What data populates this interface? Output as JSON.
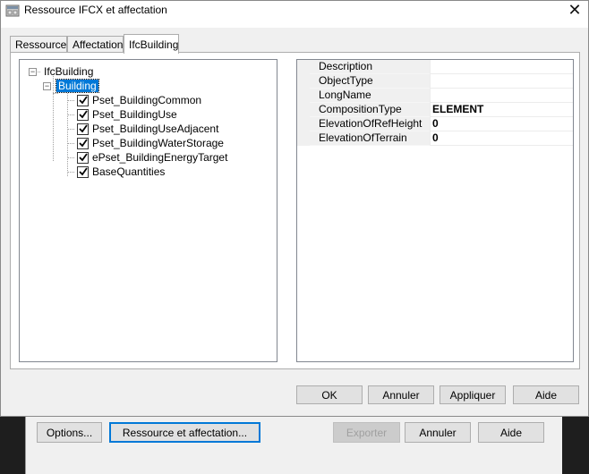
{
  "window": {
    "title": "Ressource IFCX et affectation",
    "close_glyph": "✕"
  },
  "tabs": [
    {
      "label": "Ressource"
    },
    {
      "label": "Affectation"
    },
    {
      "label": "IfcBuilding",
      "active": true
    }
  ],
  "tree": {
    "root": {
      "label": "IfcBuilding",
      "expander": "−"
    },
    "child": {
      "label": "Building",
      "expander": "−",
      "selected": true
    },
    "items": [
      {
        "label": "Pset_BuildingCommon",
        "checked": true
      },
      {
        "label": "Pset_BuildingUse",
        "checked": true
      },
      {
        "label": "Pset_BuildingUseAdjacent",
        "checked": true
      },
      {
        "label": "Pset_BuildingWaterStorage",
        "checked": true
      },
      {
        "label": "ePset_BuildingEnergyTarget",
        "checked": true
      },
      {
        "label": "BaseQuantities",
        "checked": true
      }
    ]
  },
  "properties": [
    {
      "name": "Description",
      "value": ""
    },
    {
      "name": "ObjectType",
      "value": ""
    },
    {
      "name": "LongName",
      "value": ""
    },
    {
      "name": "CompositionType",
      "value": "ELEMENT"
    },
    {
      "name": "ElevationOfRefHeight",
      "value": "0"
    },
    {
      "name": "ElevationOfTerrain",
      "value": "0"
    }
  ],
  "buttons": {
    "ok": "OK",
    "cancel": "Annuler",
    "apply": "Appliquer",
    "help": "Aide"
  },
  "parent_dialog": {
    "options": "Options...",
    "resource": "Ressource et affectation...",
    "export": "Exporter",
    "cancel": "Annuler",
    "help": "Aide"
  },
  "colors": {
    "selection": "#0078d7",
    "focus": "#0078d7"
  },
  "icons": [
    "app-icon",
    "close-icon",
    "expand-collapse-icon",
    "checkbox-checked-icon"
  ]
}
